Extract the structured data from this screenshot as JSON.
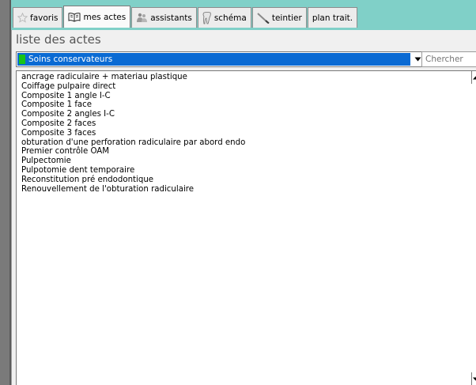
{
  "tabs": [
    {
      "label": "favoris",
      "icon": "star-icon",
      "active": false
    },
    {
      "label": "mes actes",
      "icon": "book-icon",
      "active": true
    },
    {
      "label": "assistants",
      "icon": "assistants-icon",
      "active": false
    },
    {
      "label": "schéma",
      "icon": "tooth-icon",
      "active": false
    },
    {
      "label": "teintier",
      "icon": "shade-tool-icon",
      "active": false
    },
    {
      "label": "plan trait.",
      "icon": "",
      "active": false
    }
  ],
  "panel": {
    "title": "liste des actes",
    "category": {
      "selected": "Soins conservateurs",
      "swatch_color": "#18c318"
    },
    "search": {
      "placeholder": "Chercher",
      "value": ""
    },
    "acts": [
      "ancrage radiculaire + materiau plastique",
      "Coiffage pulpaire direct",
      "Composite 1 angle I-C",
      "Composite 1 face",
      "Composite 2 angles I-C",
      "Composite 2 faces",
      "Composite 3 faces",
      "obturation d'une perforation radiculaire par abord endo",
      "Premier contrôle OAM",
      "Pulpectomie",
      "Pulpotomie dent temporaire",
      "Reconstitution pré endodontique",
      "Renouvellement de l'obturation radiculaire"
    ]
  },
  "colors": {
    "accent_selection": "#0a6ad3",
    "header_teal": "#80d0c8",
    "outer_background": "#808080"
  }
}
